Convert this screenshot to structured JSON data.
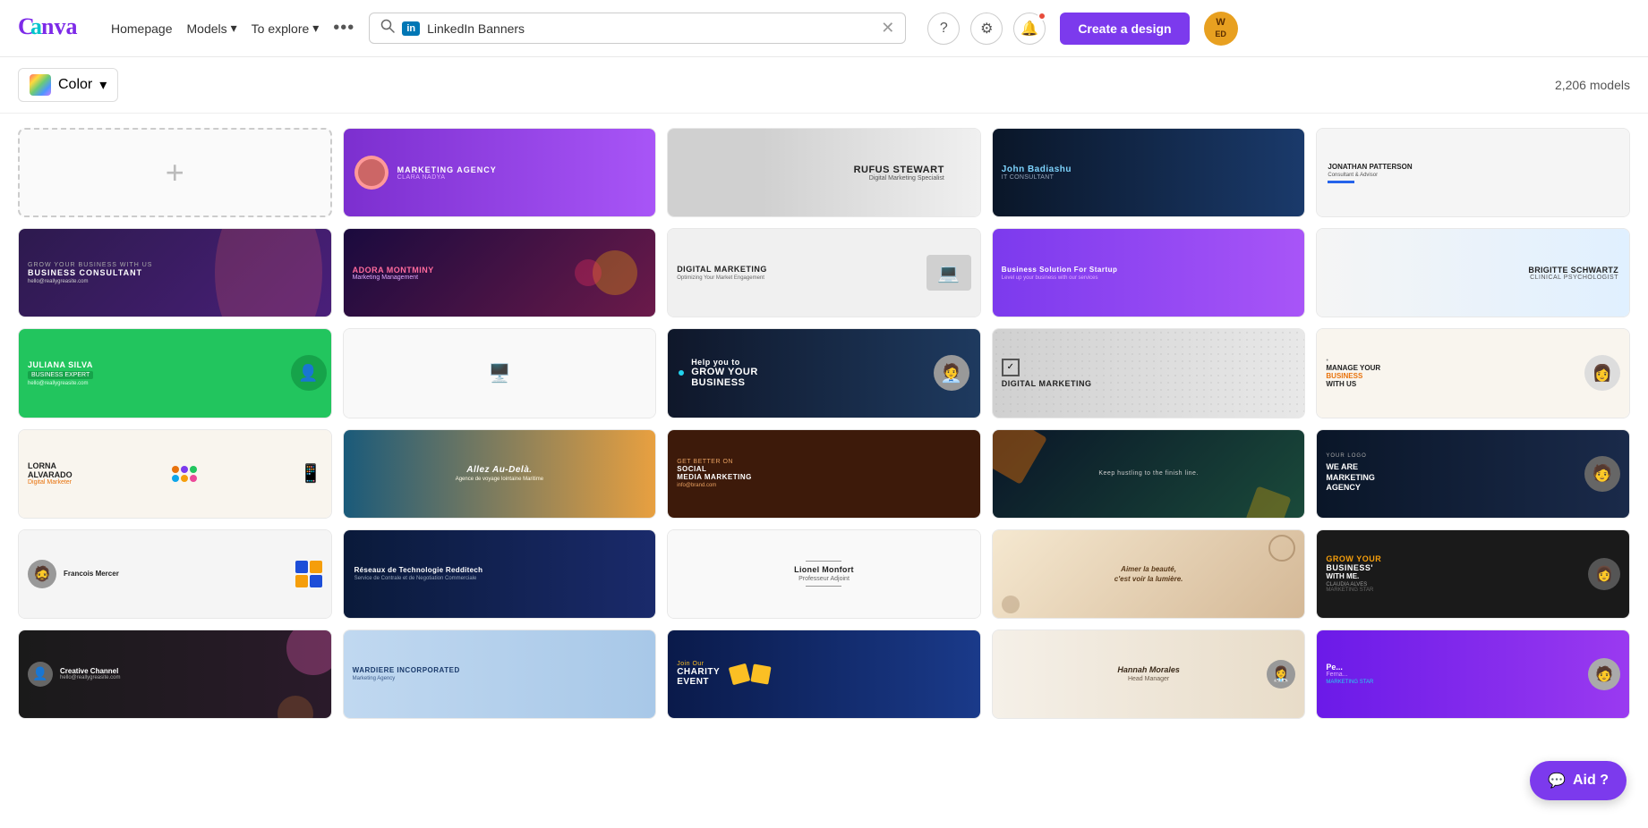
{
  "header": {
    "logo": "Canva",
    "nav": [
      {
        "label": "Homepage"
      },
      {
        "label": "Models",
        "hasDropdown": true
      },
      {
        "label": "To explore",
        "hasDropdown": true
      }
    ],
    "search": {
      "placeholder": "LinkedIn Banners",
      "value": "LinkedIn Banners",
      "badge": "in"
    },
    "create_btn": "Create a design",
    "avatar": "W\nED"
  },
  "toolbar": {
    "color_filter": "Color",
    "models_count": "2,206 models"
  },
  "templates": [
    {
      "id": "add",
      "type": "add"
    },
    {
      "id": "marketing-agency",
      "title": "MARKETING AGENCY",
      "subtitle": "CLARA NADYA",
      "style": "purple-gradient"
    },
    {
      "id": "rufus",
      "title": "RUFUS STEWART",
      "subtitle": "Digital Marketing Specialist",
      "style": "light"
    },
    {
      "id": "john",
      "title": "John Badiashu",
      "subtitle": "IT CONSULTANT",
      "style": "dark-blue"
    },
    {
      "id": "jonathan",
      "title": "JONATHAN PATTERSON",
      "style": "light-gray"
    },
    {
      "id": "business-consultant",
      "title": "BUSINESS CONSULTANT",
      "style": "dark-purple"
    },
    {
      "id": "adora",
      "title": "ADORA MONTMINY",
      "subtitle": "Marketing Management",
      "style": "dark-pink"
    },
    {
      "id": "digital-marketing-1",
      "title": "DIGITAL MARKETING",
      "subtitle": "Optimizing Your Market Engagement",
      "style": "light-gray2"
    },
    {
      "id": "business-solution",
      "title": "Business Solution For Startup",
      "style": "purple"
    },
    {
      "id": "brigitte",
      "title": "BRIGITTE SCHWARTZ",
      "subtitle": "CLINICAL PSYCHOLOGIST",
      "style": "light-blue"
    },
    {
      "id": "juliana",
      "title": "JULIANA SILVA",
      "subtitle": "BUSINESS EXPERT",
      "style": "green"
    },
    {
      "id": "laptop",
      "style": "white"
    },
    {
      "id": "grow-business",
      "title": "GROW YOUR BUSINESS",
      "style": "dark-teal"
    },
    {
      "id": "digital-marketing-2",
      "title": "DIGITAL MARKETING",
      "style": "gray-dots"
    },
    {
      "id": "manage-business",
      "title": "MANAGE YOUR BUSINESS WITH US",
      "style": "cream"
    },
    {
      "id": "lorna",
      "title": "LORNA ALVARADO",
      "subtitle": "Digital Marketer",
      "style": "cream2"
    },
    {
      "id": "allez",
      "title": "Allez Au-Delà.",
      "subtitle": "Agence de voyage lointaine Maritime",
      "style": "sunset"
    },
    {
      "id": "social-media",
      "title": "GET BETTER ON SOCIAL MEDIA MARKETING",
      "style": "brown"
    },
    {
      "id": "keep-hustling",
      "title": "Keep hustling to the finish line.",
      "style": "dark-diagonal"
    },
    {
      "id": "marketing-agency2",
      "title": "WE ARE MARKETING AGENCY",
      "style": "dark-navy"
    },
    {
      "id": "francois",
      "title": "Francois Mercer",
      "style": "white-geo"
    },
    {
      "id": "reseaux",
      "title": "Réseaux de Technologie Redditech",
      "subtitle": "Service de Contrale et de Negotiation Commerciale",
      "style": "dark-navy2"
    },
    {
      "id": "lionel",
      "title": "Lionel Monfort",
      "subtitle": "Professeur Adjoint",
      "style": "white2"
    },
    {
      "id": "aimer",
      "title": "Aimer la beauté, c'est voir la lumière.",
      "style": "warm-abstract"
    },
    {
      "id": "grow-business2",
      "title": "GROW YOUR BUSINESS WITH ME.",
      "subtitle": "CLAUDIA ALVES",
      "style": "dark"
    },
    {
      "id": "creative",
      "title": "Creative Channel",
      "style": "dark-pink2"
    },
    {
      "id": "wardiere",
      "title": "WARDIERE INCORPORATED",
      "subtitle": "Marketing Agency",
      "style": "light-blue2"
    },
    {
      "id": "charity",
      "title": "Join Our CHARITY EVENT",
      "style": "dark-blue2"
    },
    {
      "id": "hannah",
      "title": "Hannah Morales",
      "subtitle": "Head Manager",
      "style": "cream3"
    },
    {
      "id": "pedro",
      "title": "Pe... Ferna...",
      "style": "purple2"
    }
  ],
  "aid_btn": "Aid ?",
  "icons": {
    "search": "🔍",
    "question": "?",
    "settings": "⚙",
    "bell": "🔔",
    "chevron_down": "▾",
    "dots": "•••",
    "close": "✕",
    "plus": "+"
  }
}
